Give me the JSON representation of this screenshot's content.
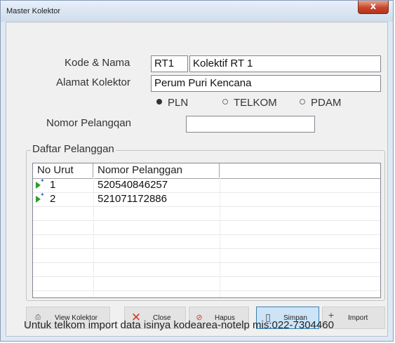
{
  "window": {
    "title": "Master Kolektor",
    "close_glyph": "x"
  },
  "form": {
    "kode_label": "Kode & Nama",
    "kode_value": "RT1",
    "nama_value": "Kolektif RT 1",
    "alamat_label": "Alamat Kolektor",
    "alamat_value": "Perum Puri Kencana",
    "radios": [
      {
        "label": "PLN",
        "selected": true
      },
      {
        "label": "TELKOM",
        "selected": false
      },
      {
        "label": "PDAM",
        "selected": false
      }
    ],
    "nomor_label": "Nomor Pelangqan",
    "nomor_value": ""
  },
  "list": {
    "group_title": "Daftar Pelanggan",
    "columns": [
      "No Urut",
      "Nomor Pelanggan"
    ],
    "rows": [
      {
        "no": "1",
        "nomor": "520540846257"
      },
      {
        "no": "2",
        "nomor": "521071172886"
      }
    ]
  },
  "buttons": {
    "view": "View Kolektor",
    "close": "Close",
    "hapus": "Hapus",
    "simpan": "Simpan",
    "import": "Import"
  },
  "footer": "Untuk telkom import data isinya kodearea-notelp mis:022-7304460"
}
